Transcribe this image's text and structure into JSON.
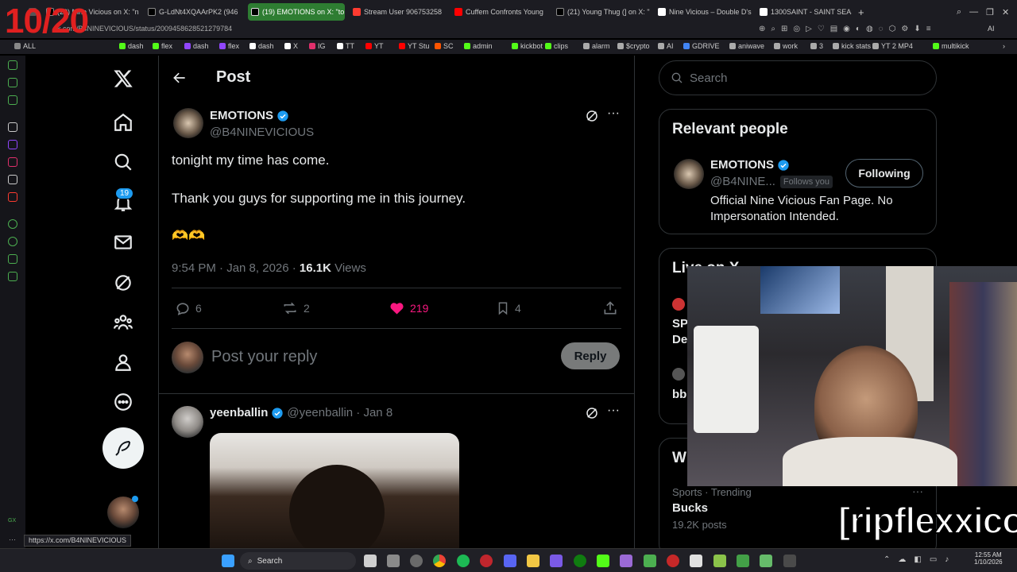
{
  "overlay": {
    "counter": "10/20",
    "watermark": "[ripflexxico]"
  },
  "browser": {
    "tabs": [
      {
        "label": "(20) Nine Vicious on X: \"n",
        "color": "#ffffff"
      },
      {
        "label": "G-LdNt4XQAArPK2 (946",
        "color": "#ffffff"
      },
      {
        "label": "(19) EMOTIONS on X: \"to",
        "color": "#ffffff"
      },
      {
        "label": "Stream User 906753258",
        "color": "#ff3b30"
      },
      {
        "label": "Cuffem Confronts Young",
        "color": "#ff0000"
      },
      {
        "label": "(21) Young Thug (] on X: \"",
        "color": "#ffffff"
      },
      {
        "label": "Nine Vicious – Double D's",
        "color": "#ffffff"
      },
      {
        "label": "1300SAINT - SAINT SEAS",
        "color": "#ffffff"
      }
    ],
    "url": "x.com/B4NINEVICIOUS/status/2009458628521279784",
    "bookmarks": [
      {
        "label": "ALL",
        "color": "#888"
      },
      {
        "label": "dash",
        "color": "#53fc18"
      },
      {
        "label": "flex",
        "color": "#53fc18"
      },
      {
        "label": "dash",
        "color": "#9146ff"
      },
      {
        "label": "flex",
        "color": "#9146ff"
      },
      {
        "label": "dash",
        "color": "#ffffff"
      },
      {
        "label": "X",
        "color": "#ffffff"
      },
      {
        "label": "IG",
        "color": "#e1306c"
      },
      {
        "label": "TT",
        "color": "#ffffff"
      },
      {
        "label": "YT",
        "color": "#ff0000"
      },
      {
        "label": "YT Stu",
        "color": "#ff0000"
      },
      {
        "label": "SC",
        "color": "#ff5500"
      },
      {
        "label": "admin",
        "color": "#53fc18"
      },
      {
        "label": "kickbot",
        "color": "#53fc18"
      },
      {
        "label": "clips",
        "color": "#53fc18"
      },
      {
        "label": "alarm",
        "color": "#aaaaaa"
      },
      {
        "label": "$crypto",
        "color": "#aaaaaa"
      },
      {
        "label": "AI",
        "color": "#aaaaaa"
      },
      {
        "label": "GDRIVE",
        "color": "#4285f4"
      },
      {
        "label": "aniwave",
        "color": "#aaaaaa"
      },
      {
        "label": "work",
        "color": "#aaaaaa"
      },
      {
        "label": "3",
        "color": "#aaaaaa"
      },
      {
        "label": "kick stats",
        "color": "#aaaaaa"
      },
      {
        "label": "YT 2 MP4",
        "color": "#aaaaaa"
      },
      {
        "label": "multikick",
        "color": "#53fc18"
      }
    ],
    "status_url": "https://x.com/B4NINEVICIOUS"
  },
  "nav": {
    "notification_count": "19"
  },
  "post": {
    "header_title": "Post",
    "author_name": "EMOTIONS",
    "author_handle": "@B4NINEVICIOUS",
    "line1": "tonight my time has come.",
    "line2": "Thank you guys for supporting me in this journey.",
    "emoji": "🫶🫶",
    "time": "9:54 PM · Jan 8, 2026 · ",
    "views_count": "16.1K",
    "views_label": " Views",
    "replies": "6",
    "reposts": "2",
    "likes": "219",
    "bookmarks": "4",
    "reply_placeholder": "Post your reply",
    "reply_button": "Reply",
    "like_color": "#f91880"
  },
  "reply": {
    "name": "yeenballin",
    "handle_date": "@yeenballin · Jan 8"
  },
  "sidebar": {
    "search_placeholder": "Search",
    "relevant_title": "Relevant people",
    "person_name": "EMOTIONS",
    "person_handle": "@B4NINE...",
    "follows_you": "Follows you",
    "following_button": "Following",
    "bio": "Official Nine Vicious Fan Page. No Impersonation Intended.",
    "live_title": "Live on X",
    "live1_a": "SP",
    "live1_b": "De",
    "live2": "bb",
    "whats_title": "W",
    "trend_meta": "Sports · Trending",
    "trend_name": "Bucks",
    "trend_posts": "19.2K posts"
  },
  "taskbar": {
    "search": "Search",
    "time": "12:55 AM",
    "date": "1/10/2026"
  }
}
